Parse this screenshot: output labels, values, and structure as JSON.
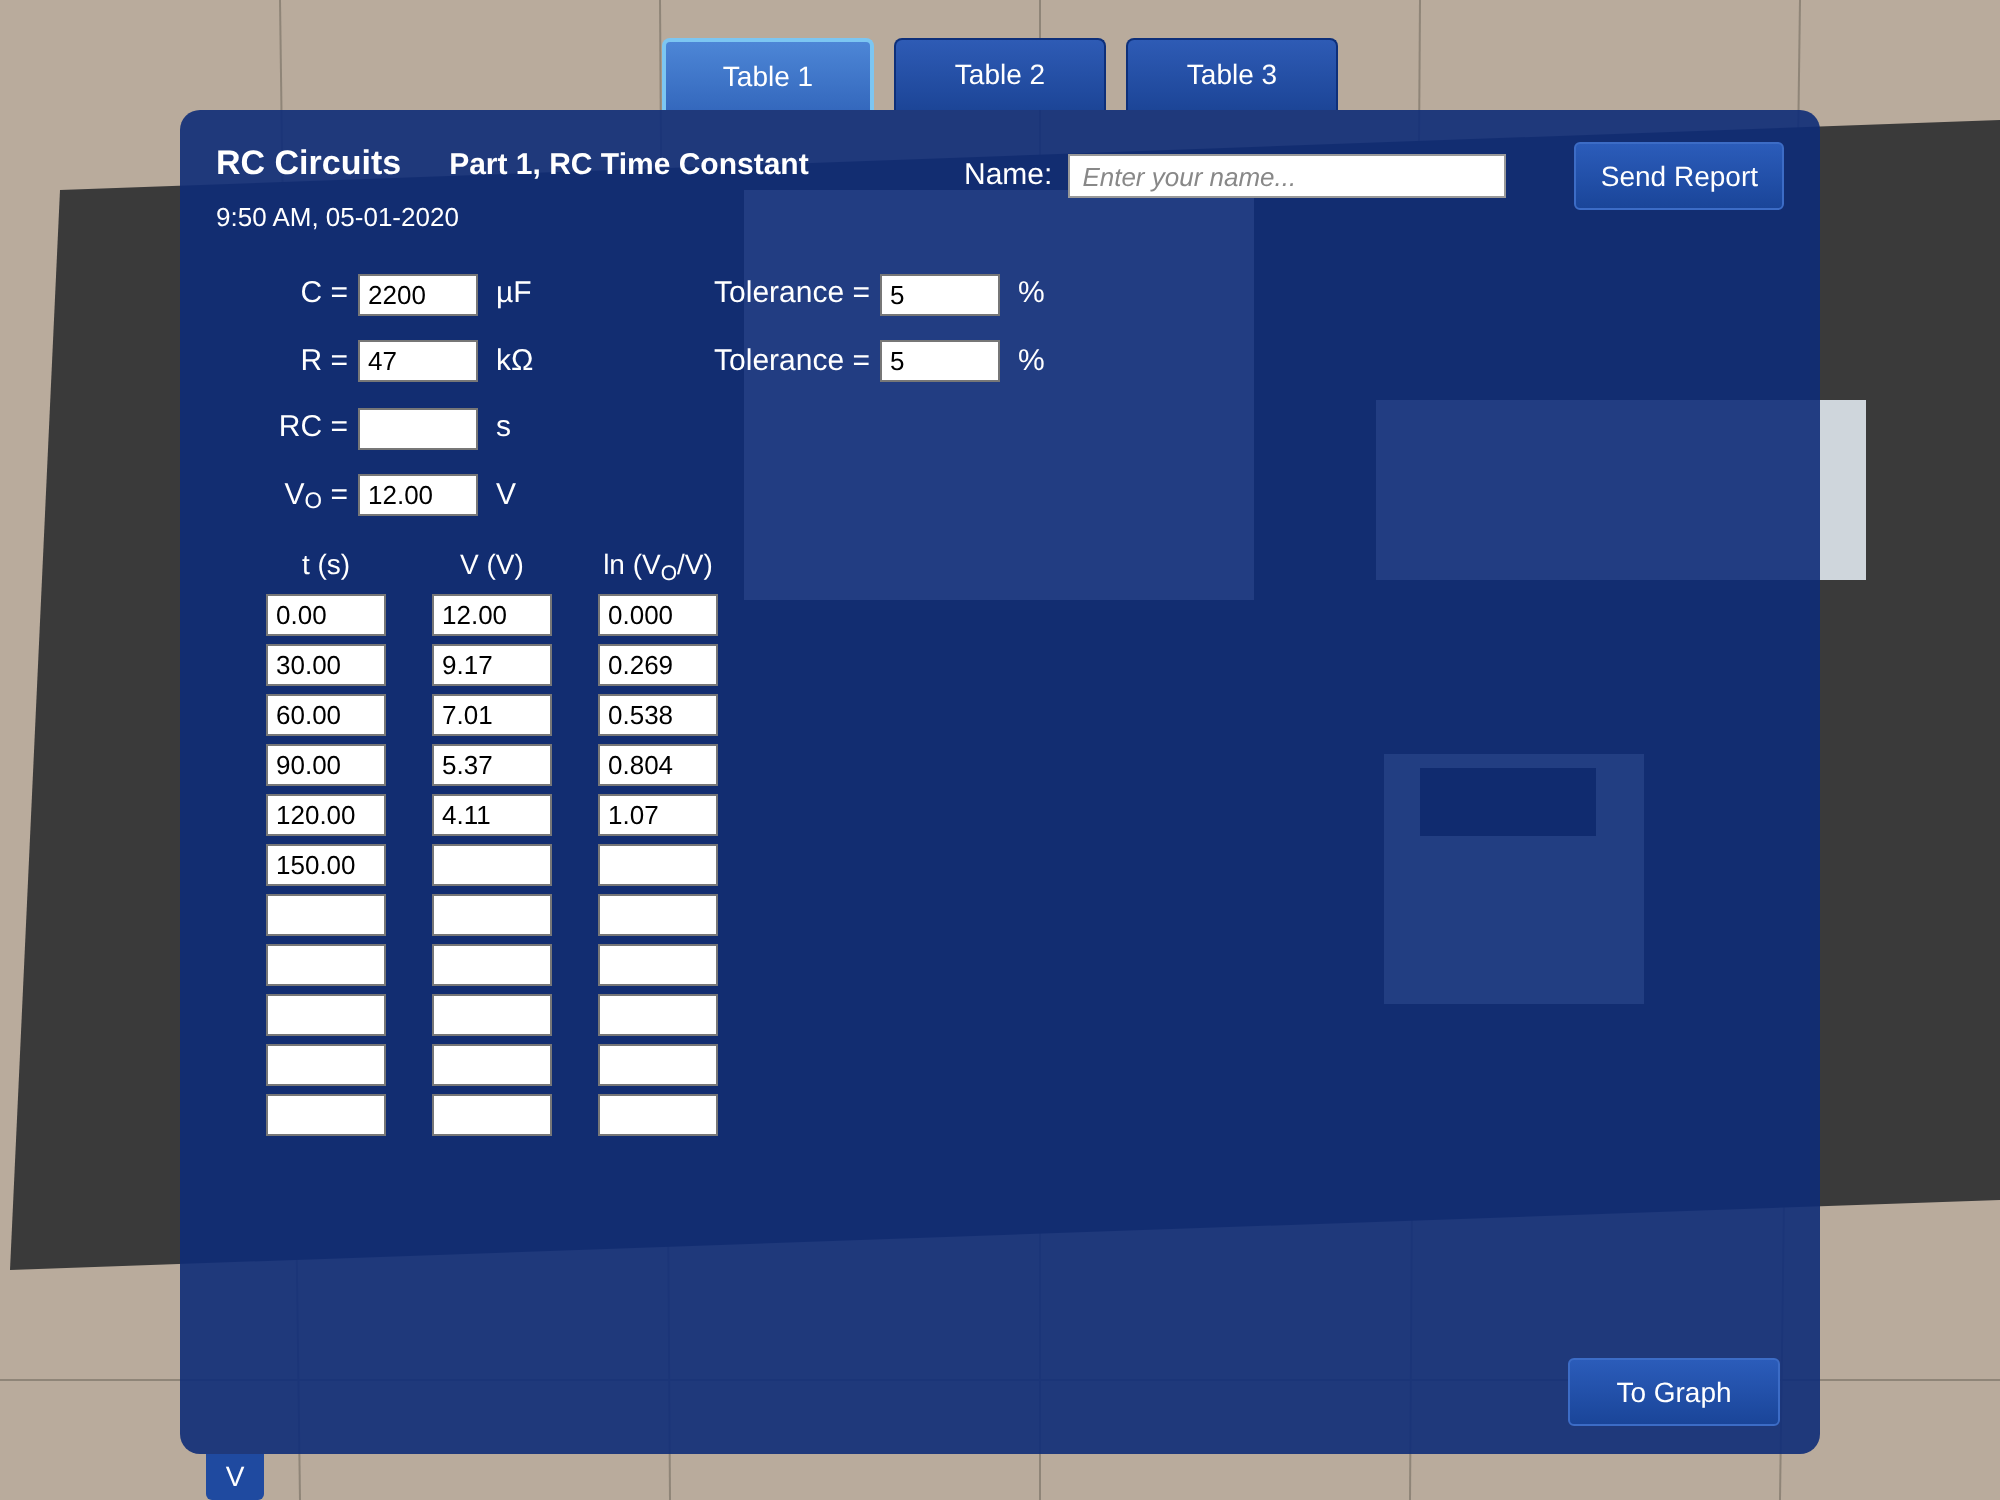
{
  "tabs": [
    {
      "label": "Table 1",
      "selected": true
    },
    {
      "label": "Table 2",
      "selected": false
    },
    {
      "label": "Table 3",
      "selected": false
    }
  ],
  "header": {
    "title": "RC Circuits",
    "subtitle": "Part 1, RC Time Constant",
    "timestamp": "9:50 AM, 05-01-2020",
    "name_label": "Name:",
    "name_placeholder": "Enter your name...",
    "send_button": "Send Report"
  },
  "quantities": [
    {
      "label": "C =",
      "value": "2200",
      "unit": "µF",
      "tolerance_label": "Tolerance =",
      "tolerance": "5",
      "tolerance_unit": "%"
    },
    {
      "label": "R =",
      "value": "47",
      "unit": "kΩ",
      "tolerance_label": "Tolerance =",
      "tolerance": "5",
      "tolerance_unit": "%"
    },
    {
      "label": "RC =",
      "unit": "s"
    },
    {
      "label": "V$_{O}$ =",
      "value": "12.00",
      "unit": "V"
    }
  ],
  "table": {
    "columns": [
      "t (s)",
      "V (V)",
      "ln (V$_{O}$/V)"
    ],
    "rows": [
      {
        "t": "0.00",
        "v": "12.00",
        "ln": "0.000"
      },
      {
        "t": "30.00",
        "v": "9.17",
        "ln": "0.269"
      },
      {
        "t": "60.00",
        "v": "7.01",
        "ln": "0.538"
      },
      {
        "t": "90.00",
        "v": "5.37",
        "ln": "0.804"
      },
      {
        "t": "120.00",
        "v": "4.11",
        "ln": "1.07"
      },
      {
        "t": "150.00"
      },
      {},
      {},
      {},
      {},
      {}
    ]
  },
  "graph_button": "To Graph",
  "collapse_button": "V"
}
